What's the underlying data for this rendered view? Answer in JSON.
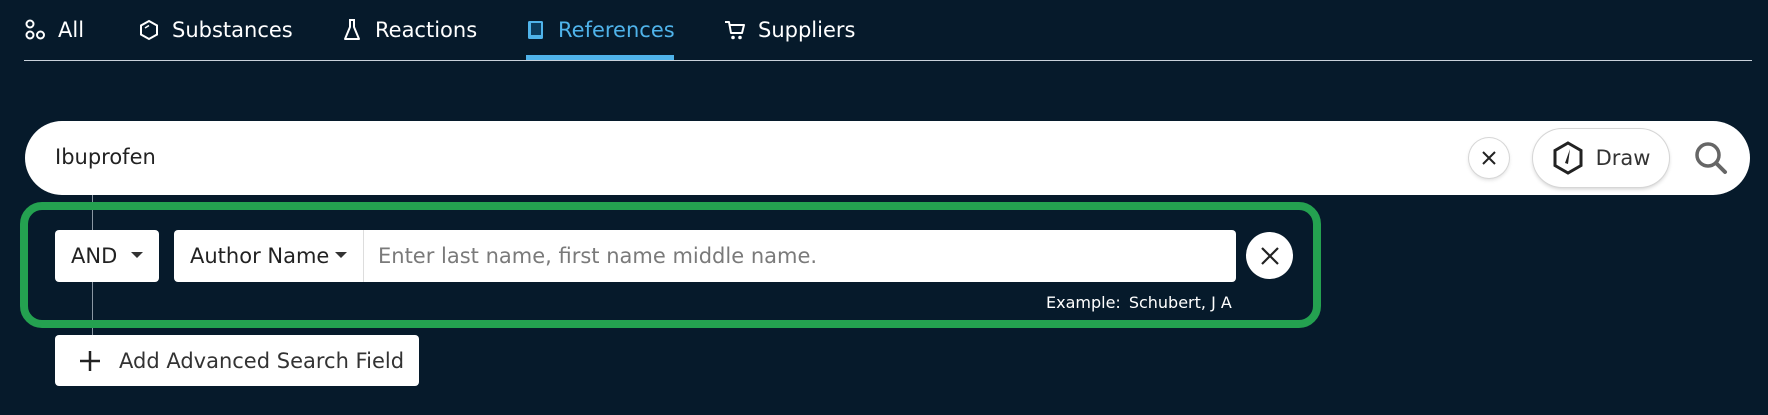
{
  "tabs": [
    {
      "label": "All",
      "icon": "all-icon",
      "active": false
    },
    {
      "label": "Substances",
      "icon": "substance-icon",
      "active": false
    },
    {
      "label": "Reactions",
      "icon": "flask-icon",
      "active": false
    },
    {
      "label": "References",
      "icon": "book-icon",
      "active": true
    },
    {
      "label": "Suppliers",
      "icon": "cart-icon",
      "active": false
    }
  ],
  "search": {
    "query": "Ibuprofen",
    "draw_label": "Draw"
  },
  "advanced": {
    "operator": "AND",
    "field": "Author Name",
    "input_value": "",
    "input_placeholder": "Enter last name, first name middle name.",
    "example_label": "Example:",
    "example_value": "Schubert, J A"
  },
  "add_field_label": "Add Advanced Search Field",
  "colors": {
    "background": "#061a2b",
    "active_tab": "#4fb3ea",
    "highlight_border": "#24a150"
  }
}
